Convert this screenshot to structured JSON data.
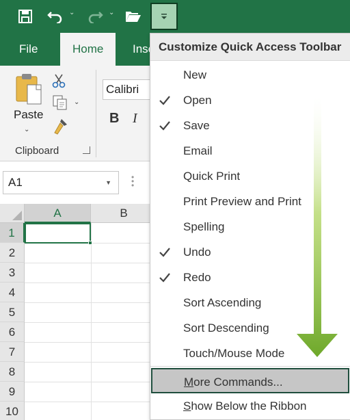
{
  "quick_access": {
    "save_icon": "save-icon",
    "undo_icon": "undo-icon",
    "redo_icon": "redo-icon",
    "open_icon": "open-folder-icon",
    "customize_icon": "customize-dropdown-icon"
  },
  "tabs": [
    {
      "label": "File"
    },
    {
      "label": "Home"
    },
    {
      "label": "Inse"
    }
  ],
  "ribbon": {
    "paste_label": "Paste",
    "clipboard_label": "Clipboard",
    "font_name": "Calibri",
    "bold_label": "B",
    "italic_label": "I"
  },
  "name_box": {
    "value": "A1"
  },
  "grid": {
    "columns": [
      "A",
      "B"
    ],
    "rows": [
      "1",
      "2",
      "3",
      "4",
      "5",
      "6",
      "7",
      "8",
      "9",
      "10"
    ]
  },
  "menu": {
    "title": "Customize Quick Access Toolbar",
    "items": [
      {
        "label": "New",
        "checked": false
      },
      {
        "label": "Open",
        "checked": true
      },
      {
        "label": "Save",
        "checked": true
      },
      {
        "label": "Email",
        "checked": false
      },
      {
        "label": "Quick Print",
        "checked": false
      },
      {
        "label": "Print Preview and Print",
        "checked": false
      },
      {
        "label": "Spelling",
        "checked": false
      },
      {
        "label": "Undo",
        "checked": true
      },
      {
        "label": "Redo",
        "checked": true
      },
      {
        "label": "Sort Ascending",
        "checked": false
      },
      {
        "label": "Sort Descending",
        "checked": false
      },
      {
        "label": "Touch/Mouse Mode",
        "checked": false
      }
    ],
    "more_commands_first": "M",
    "more_commands_rest": "ore Commands...",
    "show_below_first": "S",
    "show_below_rest": "how Below the Ribbon"
  },
  "colors": {
    "excel_green": "#217346",
    "highlight_border": "#1f4e3d",
    "arrow_green": "#8dc63f"
  }
}
